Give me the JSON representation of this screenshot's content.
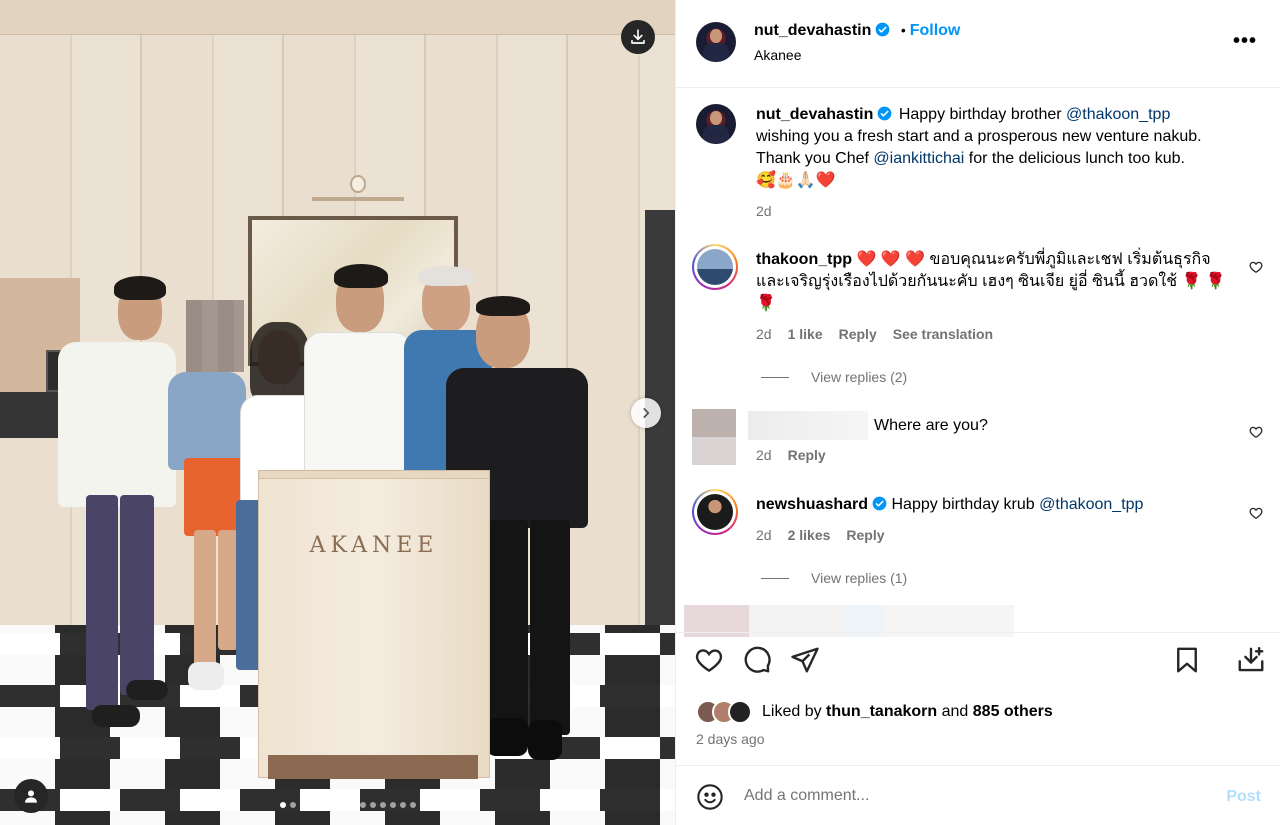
{
  "post": {
    "author": "nut_devahastin",
    "follow_label": "Follow",
    "separator": "•",
    "location": "Akanee",
    "more_label": "•••",
    "caption_text_1": "Happy birthday brother ",
    "caption_mention_1": "@thakoon_tpp",
    "caption_text_2": "wishing you a fresh start and a prosperous new venture nakub.",
    "caption_text_3": "Thank you Chef ",
    "caption_mention_2": "@iankittichai",
    "caption_text_4": " for the delicious lunch too kub.",
    "caption_emoji": "🥰🎂🙏🏻❤️",
    "caption_time": "2d",
    "podium_text": "AKANEE"
  },
  "comments": [
    {
      "user": "thakoon_tpp",
      "text_1": "❤️ ❤️ ❤️ ขอบคุณนะครับพี่ภูมิและเชฟ เริ่มต้นธุรกิจ",
      "text_2": "และเจริญรุ่งเรืองไปด้วยกันนะคับ เฮงๆ ซินเจีย ยู่อี่ ซินนี้ ฮวดใช้ 🌹 🌹",
      "text_3": "🌹",
      "time": "2d",
      "likes": "1 like",
      "reply": "Reply",
      "translate": "See translation",
      "view_replies": "View replies (2)"
    },
    {
      "text": "Where are you?",
      "time": "2d",
      "reply": "Reply"
    },
    {
      "user": "newshuashard",
      "text": "Happy birthday krub ",
      "mention": "@thakoon_tpp",
      "time": "2d",
      "likes": "2 likes",
      "reply": "Reply",
      "view_replies": "View replies (1)"
    }
  ],
  "footer": {
    "liked_by_prefix": "Liked by ",
    "liked_by_user": "thun_tanakorn",
    "liked_by_and": " and ",
    "liked_by_count": "885 others",
    "date": "2 days ago",
    "add_comment_placeholder": "Add a comment...",
    "post_label": "Post"
  },
  "colors": {
    "link": "#0095f6",
    "mention": "#00376b",
    "muted": "#737373",
    "verified": "#0095f6"
  },
  "icons": [
    "download-icon",
    "chevron-right-icon",
    "user-tag-icon",
    "verified-icon",
    "heart-icon",
    "comment-icon",
    "share-icon",
    "bookmark-icon",
    "save-to-collection-icon",
    "emoji-icon"
  ]
}
